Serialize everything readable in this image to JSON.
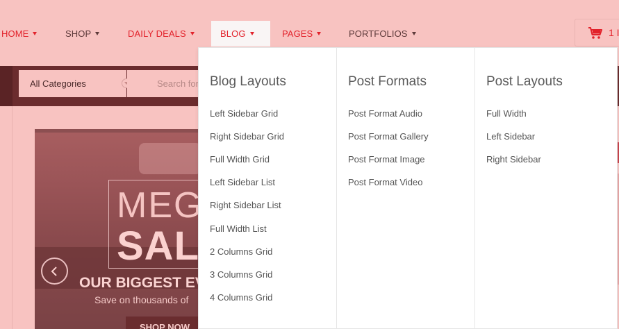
{
  "nav": {
    "items": [
      {
        "label": "HOME"
      },
      {
        "label": "SHOP"
      },
      {
        "label": "DAILY DEALS"
      },
      {
        "label": "BLOG"
      },
      {
        "label": "PAGES"
      },
      {
        "label": "PORTFOLIOS"
      }
    ],
    "cart_count": "1 I"
  },
  "search": {
    "category": "All Categories",
    "placeholder": "Search for"
  },
  "slider": {
    "mega_text": "MEG",
    "sale_text": "SAL",
    "headline": "OUR BIGGEST EV",
    "subline": "Save on thousands of",
    "button_label": "SHOP NOW"
  },
  "mega_menu": {
    "columns": [
      {
        "title": "Blog Layouts",
        "links": [
          "Left Sidebar Grid",
          "Right Sidebar Grid",
          "Full Width Grid",
          "Left Sidebar List",
          "Right Sidebar List",
          "Full Width List",
          "2 Columns Grid",
          "3 Columns Grid",
          "4 Columns Grid"
        ]
      },
      {
        "title": "Post Formats",
        "links": [
          "Post Format Audio",
          "Post Format Gallery",
          "Post Format Image",
          "Post Format Video"
        ]
      },
      {
        "title": "Post Layouts",
        "links": [
          "Full Width",
          "Left Sidebar",
          "Right Sidebar"
        ]
      }
    ]
  },
  "colors": {
    "page_bg": "#f8c3c1",
    "accent_red": "#e2222b",
    "search_strip": "#6b2c2e",
    "menu_bg": "#ffffff"
  },
  "icons": {
    "cart": "shopping-cart-icon",
    "prev": "chevron-left-icon",
    "caret": "caret-down-icon"
  }
}
